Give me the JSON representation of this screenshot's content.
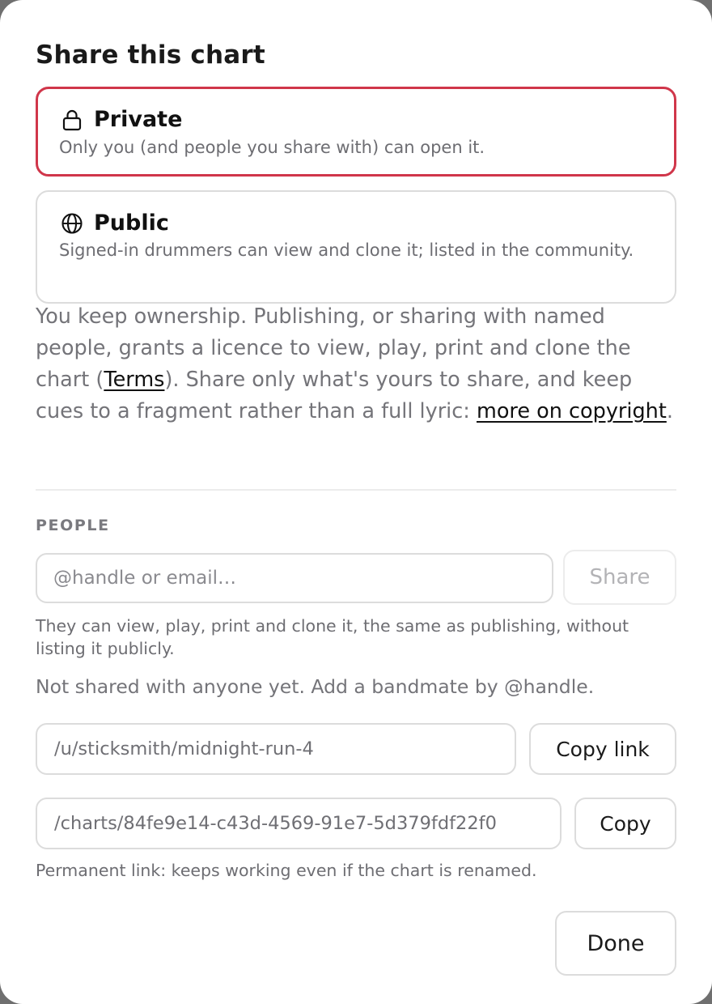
{
  "dialog": {
    "title": "Share this chart"
  },
  "visibility": {
    "selected": "private",
    "accent_color": "#d0364a",
    "private": {
      "icon": "lock-icon",
      "label": "Private",
      "description": "Only you (and people you share with) can open it."
    },
    "public": {
      "icon": "globe-icon",
      "label": "Public",
      "description": "Signed-in drummers can view and clone it; listed in the community."
    }
  },
  "notice": {
    "part1": "You keep ownership. Publishing, or sharing with named people, grants a licence to view, play, print and clone the chart (",
    "terms_link": "Terms",
    "part2": "). Share only what's yours to share, and keep cues to a fragment rather than a full lyric: ",
    "copyright_link": "more on copyright",
    "part3": "."
  },
  "people": {
    "section_label": "PEOPLE",
    "input_placeholder": "@handle or email…",
    "input_value": "",
    "share_label": "Share",
    "hint": "They can view, play, print and clone it, the same as publishing, without listing it publicly.",
    "empty_note": "Not shared with anyone yet. Add a bandmate by @handle."
  },
  "links": {
    "named_url": "/u/sticksmith/midnight-run-4",
    "copy_link_label": "Copy link",
    "permanent_url": "/charts/84fe9e14-c43d-4569-91e7-5d379fdf22f0",
    "copy_label": "Copy",
    "permanent_hint": "Permanent link: keeps working even if the chart is renamed."
  },
  "footer": {
    "done_label": "Done"
  }
}
